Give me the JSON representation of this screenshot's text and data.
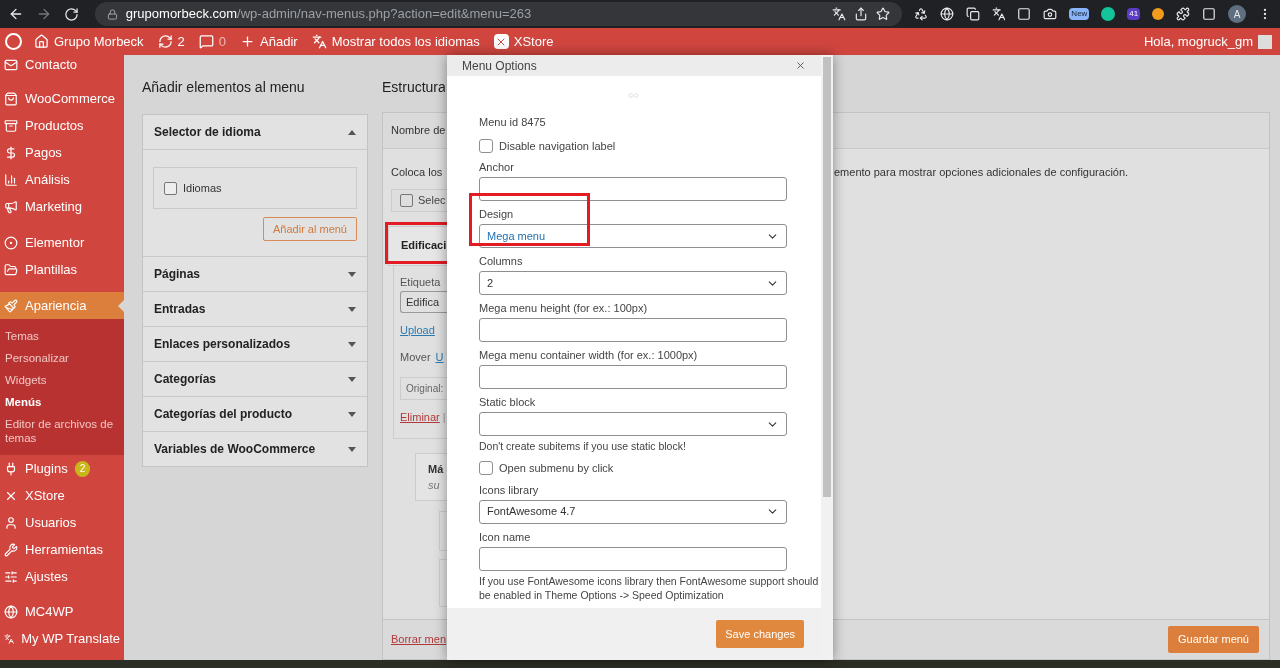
{
  "browser": {
    "url_host": "grupomorbeck.com",
    "url_path": "/wp-admin/nav-menus.php?action=edit&menu=263",
    "badges": [
      "New",
      "41"
    ],
    "avatar": "A"
  },
  "admin_bar": {
    "items": [
      {
        "kind": "wp"
      },
      {
        "kind": "home",
        "label": "Grupo Morbeck"
      },
      {
        "kind": "updates",
        "label": "2"
      },
      {
        "kind": "comments",
        "label": "0"
      },
      {
        "kind": "new",
        "label": "Añadir"
      },
      {
        "kind": "languages",
        "label": "Mostrar todos los idiomas"
      },
      {
        "kind": "xstore",
        "label": "XStore"
      }
    ],
    "greeting": "Hola, mogruck_gm"
  },
  "sidebar": {
    "items": [
      {
        "kind": "mail",
        "label": "Contacto",
        "selected": false
      },
      {
        "kind": "woo",
        "label": "WooCommerce",
        "selected": false
      },
      {
        "kind": "box",
        "label": "Productos",
        "selected": false
      },
      {
        "kind": "dollar",
        "label": "Pagos",
        "selected": false
      },
      {
        "kind": "chart",
        "label": "Análisis",
        "selected": false
      },
      {
        "kind": "megaphone",
        "label": "Marketing",
        "selected": false
      },
      {
        "kind": "elementor",
        "label": "Elementor",
        "selected": false
      },
      {
        "kind": "folder",
        "label": "Plantillas",
        "selected": false
      },
      {
        "kind": "brush",
        "label": "Apariencia",
        "selected": true,
        "children": [
          {
            "label": "Temas",
            "selected": false
          },
          {
            "label": "Personalizar",
            "selected": false
          },
          {
            "label": "Widgets",
            "selected": false
          },
          {
            "label": "Menús",
            "selected": true
          },
          {
            "label": "Editor de archivos de temas",
            "selected": false
          }
        ]
      },
      {
        "kind": "plug",
        "label": "Plugins",
        "badge": "2",
        "selected": false
      },
      {
        "kind": "xstore",
        "label": "XStore",
        "selected": false
      },
      {
        "kind": "user",
        "label": "Usuarios",
        "selected": false
      },
      {
        "kind": "wrench",
        "label": "Herramientas",
        "selected": false
      },
      {
        "kind": "sliders",
        "label": "Ajustes",
        "selected": false
      },
      {
        "kind": "mc4wp",
        "label": "MC4WP",
        "selected": false
      },
      {
        "kind": "translate",
        "label": "My WP Translate",
        "selected": false
      }
    ]
  },
  "add_items": {
    "title": "Añadir elementos al menu",
    "sections": [
      {
        "label": "Selector de idioma",
        "expanded": true,
        "options": [
          {
            "label": "Idiomas",
            "checked": false
          }
        ],
        "button": "Añadir al menú"
      },
      {
        "label": "Páginas",
        "expanded": false
      },
      {
        "label": "Entradas",
        "expanded": false
      },
      {
        "label": "Enlaces personalizados",
        "expanded": false
      },
      {
        "label": "Categorías",
        "expanded": false
      },
      {
        "label": "Categorías del producto",
        "expanded": false
      },
      {
        "label": "Variables de WooCommerce",
        "expanded": false
      }
    ]
  },
  "structure": {
    "title": "Estructura",
    "name_label": "Nombre de",
    "instructions_start": "Coloca los",
    "instructions_end": "emento para mostrar opciones adicionales de configuración.",
    "select_all": {
      "label": "Selec",
      "checked": false
    },
    "item": {
      "title": "Edificaci",
      "highlighted": true,
      "label_caption": "Etiqueta",
      "label_value": "Edifica",
      "upload_link": "Upload",
      "move_label": "Mover",
      "move_link": "U",
      "original": "Original:",
      "remove_link": "Eliminar",
      "separator": "|"
    },
    "sub_item": {
      "title": "Má",
      "subtitle": "su"
    },
    "delete_link": "Borrar men",
    "save_button": "Guardar menú"
  },
  "modal": {
    "title": "Menu Options",
    "menu_id": "Menu id 8475",
    "fields": [
      {
        "kind": "checkbox",
        "label": "Disable navigation label",
        "checked": false
      },
      {
        "kind": "text",
        "label": "Anchor"
      },
      {
        "kind": "select",
        "label": "Design",
        "value": "Mega menu",
        "highlighted": true
      },
      {
        "kind": "select",
        "label": "Columns",
        "value": "2"
      },
      {
        "kind": "text",
        "label": "Mega menu height (for ex.: 100px)"
      },
      {
        "kind": "text",
        "label": "Mega menu container width (for ex.: 1000px)"
      },
      {
        "kind": "select",
        "label": "Static block",
        "help": "Don't create subitems if you use static block!"
      },
      {
        "kind": "checkbox",
        "label": "Open submenu by click",
        "checked": false
      },
      {
        "kind": "select",
        "label": "Icons library",
        "value": "FontAwesome 4.7"
      },
      {
        "kind": "text",
        "label": "Icon name",
        "help": "If you use FontAwesome icons library then FontAwesome support should be enabled in Theme Options -> Speed Optimization"
      }
    ],
    "save_button": "Save changes"
  }
}
